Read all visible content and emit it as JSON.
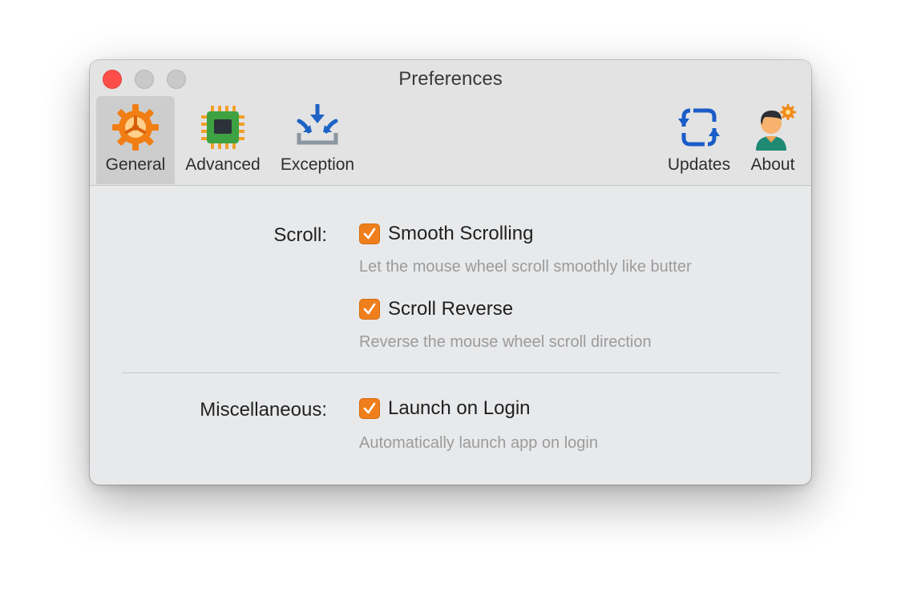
{
  "window": {
    "title": "Preferences"
  },
  "toolbar": {
    "items": [
      {
        "label": "General",
        "icon": "gear-icon",
        "selected": true
      },
      {
        "label": "Advanced",
        "icon": "chip-icon",
        "selected": false
      },
      {
        "label": "Exception",
        "icon": "exception-icon",
        "selected": false
      },
      {
        "label": "Updates",
        "icon": "refresh-icon",
        "selected": false
      },
      {
        "label": "About",
        "icon": "person-icon",
        "selected": false
      }
    ]
  },
  "sections": {
    "scroll": {
      "label": "Scroll:",
      "options": [
        {
          "label": "Smooth Scrolling",
          "description": "Let the mouse wheel scroll smoothly like butter",
          "checked": true
        },
        {
          "label": "Scroll Reverse",
          "description": "Reverse the mouse wheel scroll direction",
          "checked": true
        }
      ]
    },
    "misc": {
      "label": "Miscellaneous:",
      "options": [
        {
          "label": "Launch on Login",
          "description": "Automatically launch app on login",
          "checked": true
        }
      ]
    }
  },
  "colors": {
    "accent": "#ee7f1c",
    "close": "#fd4e4a",
    "background": "#e8e9eb"
  }
}
